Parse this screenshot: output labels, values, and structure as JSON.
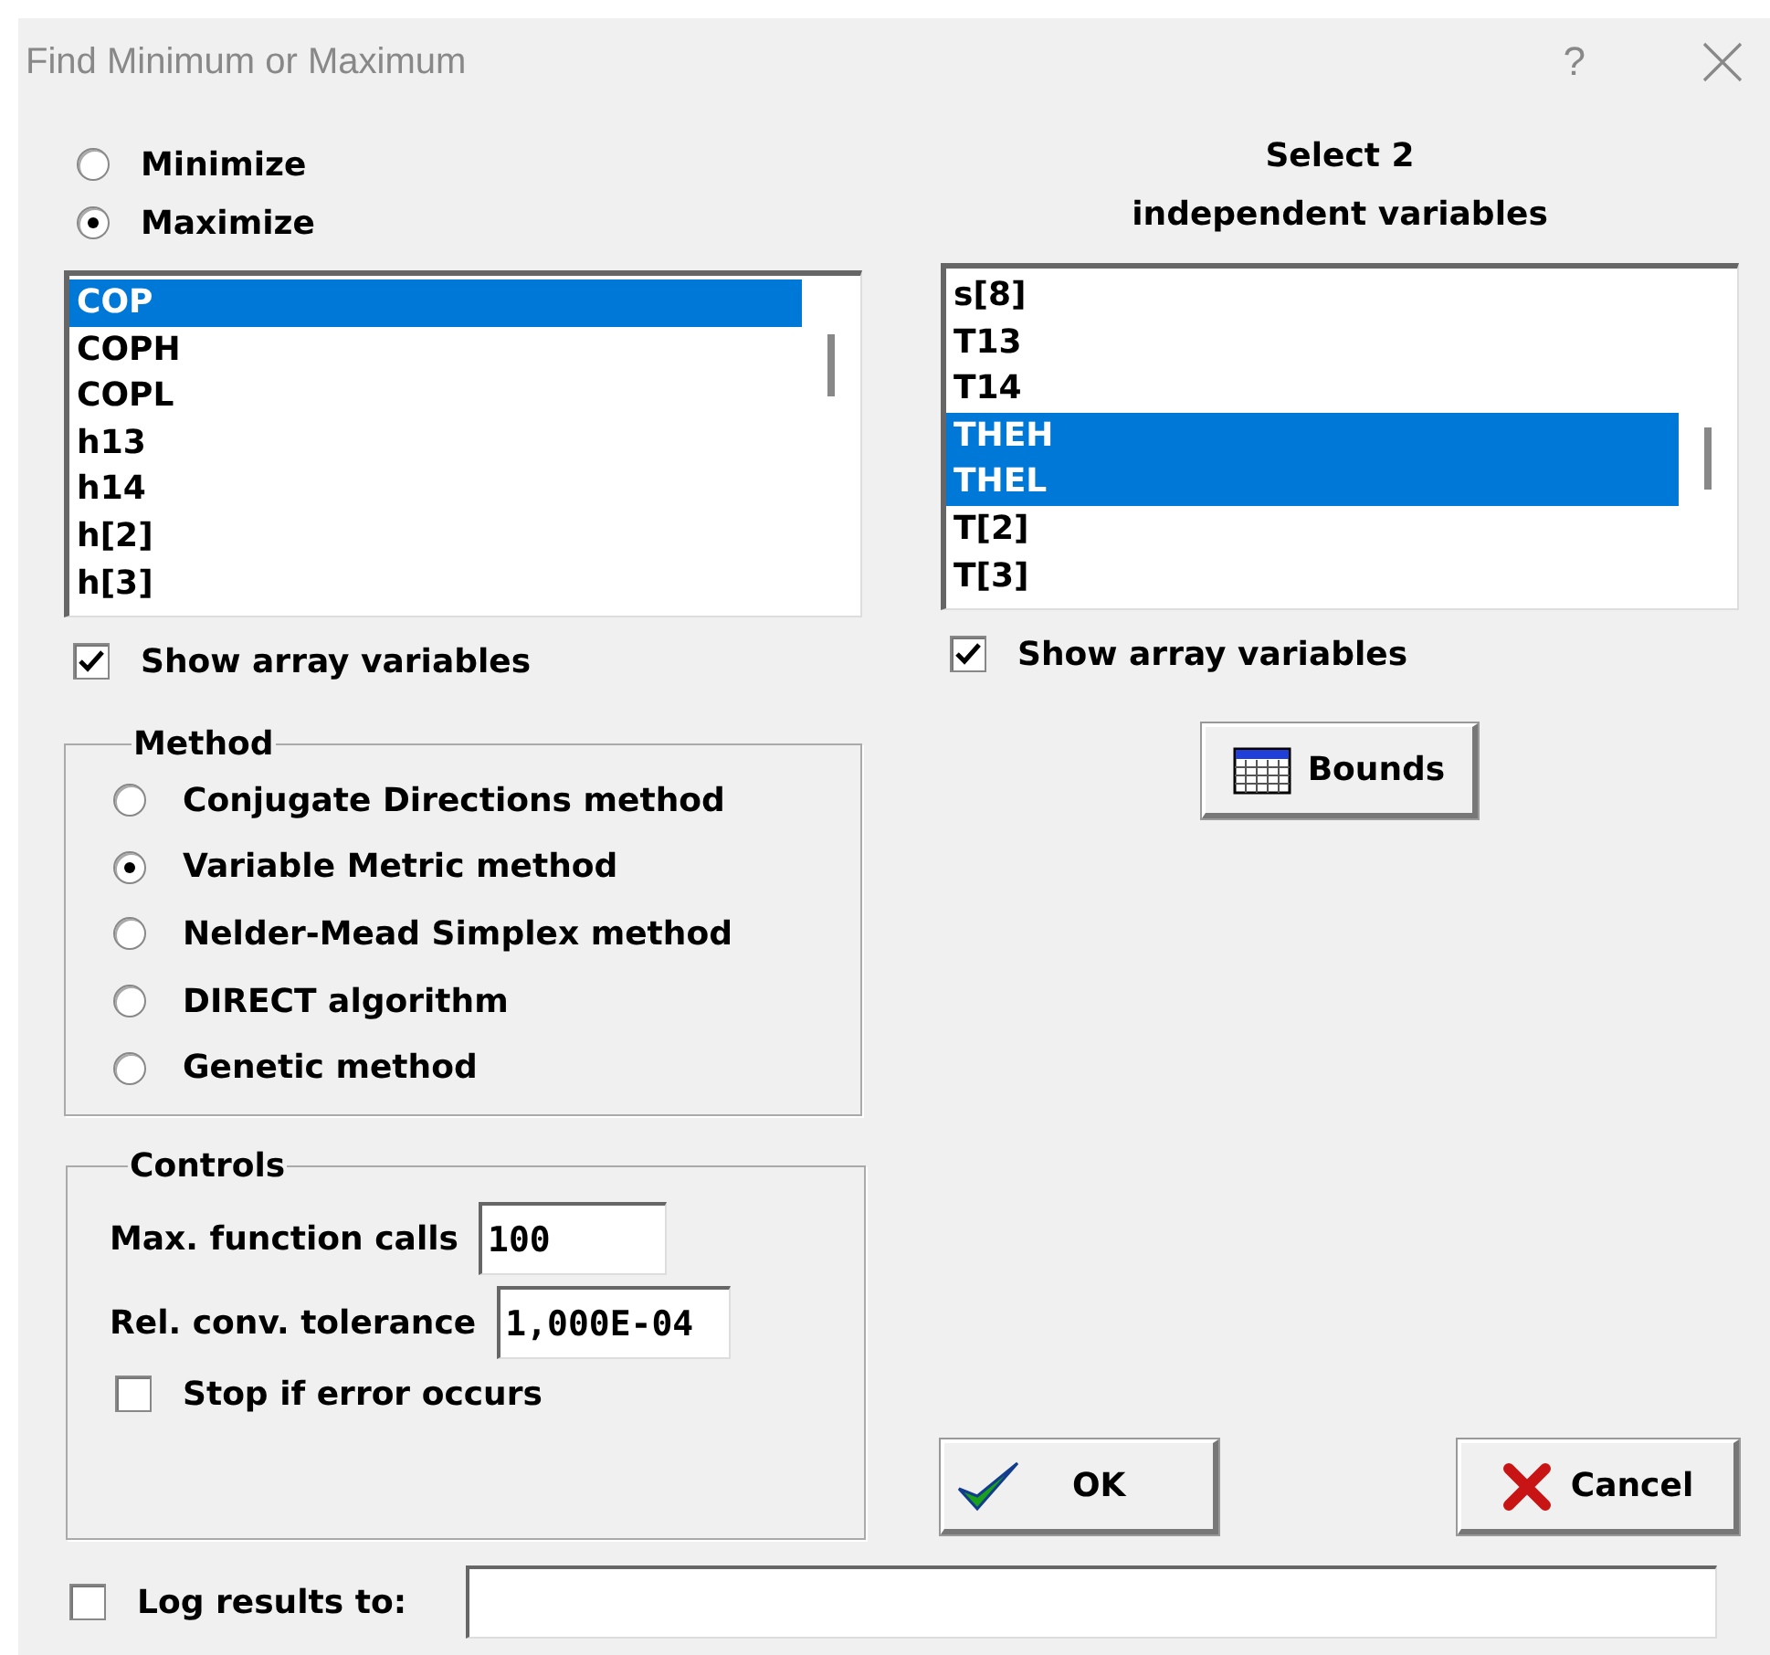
{
  "window": {
    "title": "Find Minimum or Maximum",
    "help_button": "?"
  },
  "objective": {
    "options": [
      {
        "label": "Minimize",
        "selected": false
      },
      {
        "label": "Maximize",
        "selected": true
      }
    ],
    "variables": [
      {
        "name": "COP",
        "selected": true
      },
      {
        "name": "COPH",
        "selected": false
      },
      {
        "name": "COPL",
        "selected": false
      },
      {
        "name": "h13",
        "selected": false
      },
      {
        "name": "h14",
        "selected": false
      },
      {
        "name": "h[2]",
        "selected": false
      },
      {
        "name": "h[3]",
        "selected": false
      }
    ],
    "show_array_variables": {
      "label": "Show array variables",
      "checked": true
    }
  },
  "independent": {
    "heading": "Select 2",
    "subheading": "independent variables",
    "variables": [
      {
        "name": "s[8]",
        "selected": false
      },
      {
        "name": "T13",
        "selected": false
      },
      {
        "name": "T14",
        "selected": false
      },
      {
        "name": "THEH",
        "selected": true
      },
      {
        "name": "THEL",
        "selected": true
      },
      {
        "name": "T[2]",
        "selected": false
      },
      {
        "name": "T[3]",
        "selected": false
      }
    ],
    "show_array_variables": {
      "label": "Show array variables",
      "checked": true
    }
  },
  "bounds_button": "Bounds",
  "method": {
    "title": "Method",
    "options": [
      {
        "label": "Conjugate Directions method",
        "selected": false
      },
      {
        "label": "Variable Metric method",
        "selected": true
      },
      {
        "label": "Nelder-Mead Simplex method",
        "selected": false
      },
      {
        "label": "DIRECT algorithm",
        "selected": false
      },
      {
        "label": "Genetic method",
        "selected": false
      }
    ]
  },
  "controls": {
    "title": "Controls",
    "fields": [
      {
        "label": "Max. function calls",
        "value": "100"
      },
      {
        "label": "Rel. conv. tolerance",
        "value": "1,000E-04"
      }
    ],
    "stop_if_error": {
      "label": "Stop if error occurs",
      "checked": false
    }
  },
  "buttons": [
    {
      "label": "OK",
      "kind": "ok"
    },
    {
      "label": "Cancel",
      "kind": "cancel"
    }
  ],
  "log": {
    "label": "Log results to:",
    "checked": false
  }
}
